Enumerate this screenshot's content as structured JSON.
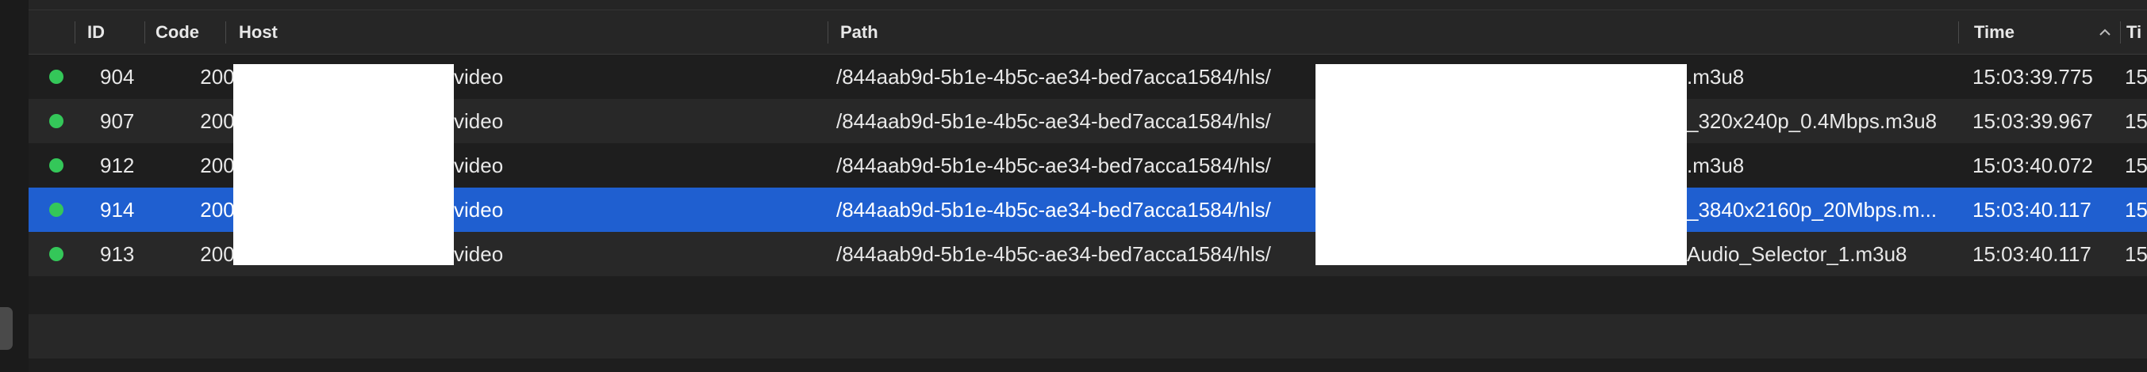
{
  "columns": {
    "id": "ID",
    "code": "Code",
    "host": "Host",
    "path": "Path",
    "time": "Time",
    "tail": "Ti"
  },
  "status_color": "#34c759",
  "selected_color": "#1f5fd0",
  "rows": [
    {
      "id": "904",
      "code": "200",
      "host": "video",
      "path_prefix": "/844aab9d-5b1e-4b5c-ae34-bed7acca1584/hls/",
      "path_suffix": ".m3u8",
      "time": "15:03:39.775",
      "tail": "15"
    },
    {
      "id": "907",
      "code": "200",
      "host": "video",
      "path_prefix": "/844aab9d-5b1e-4b5c-ae34-bed7acca1584/hls/",
      "path_suffix": "_320x240p_0.4Mbps.m3u8",
      "time": "15:03:39.967",
      "tail": "15"
    },
    {
      "id": "912",
      "code": "200",
      "host": "video",
      "path_prefix": "/844aab9d-5b1e-4b5c-ae34-bed7acca1584/hls/",
      "path_suffix": ".m3u8",
      "time": "15:03:40.072",
      "tail": "15"
    },
    {
      "id": "914",
      "code": "200",
      "host": "video",
      "path_prefix": "/844aab9d-5b1e-4b5c-ae34-bed7acca1584/hls/",
      "path_suffix": "_3840x2160p_20Mbps.m...",
      "time": "15:03:40.117",
      "tail": "15"
    },
    {
      "id": "913",
      "code": "200",
      "host": "video",
      "path_prefix": "/844aab9d-5b1e-4b5c-ae34-bed7acca1584/hls/",
      "path_suffix": "Audio_Selector_1.m3u8",
      "time": "15:03:40.117",
      "tail": "15"
    }
  ]
}
